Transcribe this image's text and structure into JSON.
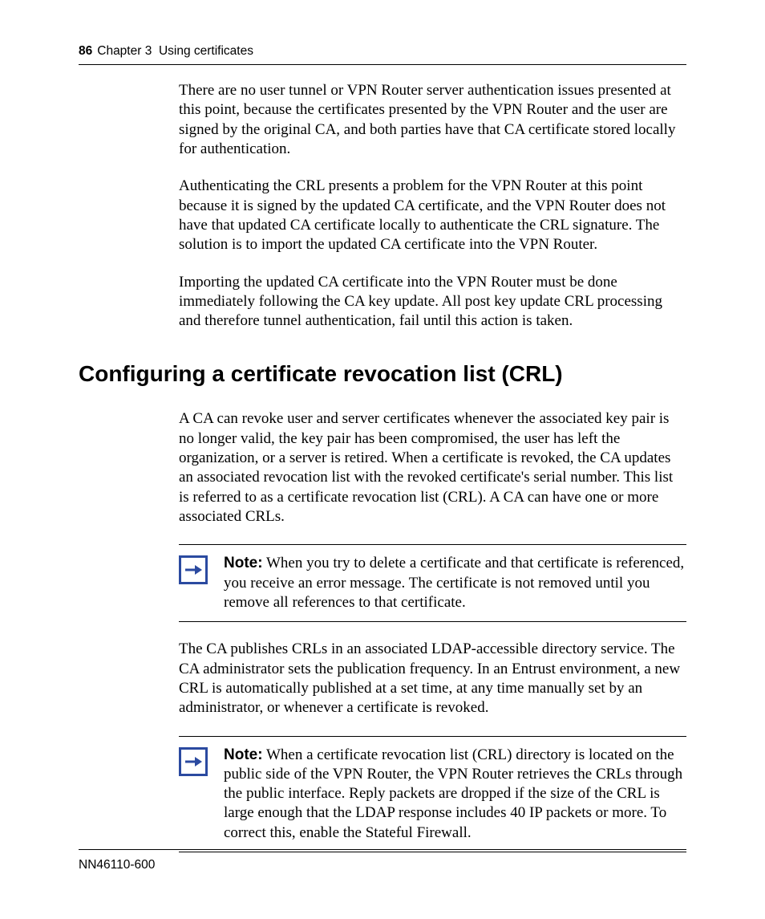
{
  "header": {
    "page_number": "86",
    "chapter_label": "Chapter 3",
    "chapter_title": "Using certificates"
  },
  "body": {
    "para1": "There are no user tunnel or VPN Router server authentication issues presented at this point, because the certificates presented by the VPN Router and the user are signed by the original CA, and both parties have that CA certificate stored locally for authentication.",
    "para2": "Authenticating the CRL presents a problem for the VPN Router at this point because it is signed by the updated CA certificate, and the VPN Router does not have that updated CA certificate locally to authenticate the CRL signature. The solution is to import the updated CA certificate into the VPN Router.",
    "para3": "Importing the updated CA certificate into the VPN Router must be done immediately following the CA key update. All post key update CRL processing and therefore tunnel authentication, fail until this action is taken."
  },
  "section_heading": "Configuring a certificate revocation list (CRL)",
  "section": {
    "para1": "A CA can revoke user and server certificates whenever the associated key pair is no longer valid, the key pair has been compromised, the user has left the organization, or a server is retired. When a certificate is revoked, the CA updates an associated revocation list with the revoked certificate's serial number. This list is referred to as a certificate revocation list (CRL). A CA can have one or more associated CRLs.",
    "para2": "The CA publishes CRLs in an associated LDAP-accessible directory service. The CA administrator sets the publication frequency. In an Entrust environment, a new CRL is automatically published at a set time, at any time manually set by an administrator, or whenever a certificate is revoked."
  },
  "notes": {
    "label": "Note:",
    "note1": "When you try to delete a certificate and that certificate is referenced, you receive an error message. The certificate is not removed until you remove all references to that certificate.",
    "note2": "When a certificate revocation list (CRL) directory is located on the public side of the VPN Router, the VPN Router retrieves the CRLs through the public interface. Reply packets are dropped if the size of the CRL is large enough that the LDAP response includes 40 IP packets or more. To correct this, enable the Stateful Firewall."
  },
  "footer": {
    "doc_number": "NN46110-600"
  }
}
